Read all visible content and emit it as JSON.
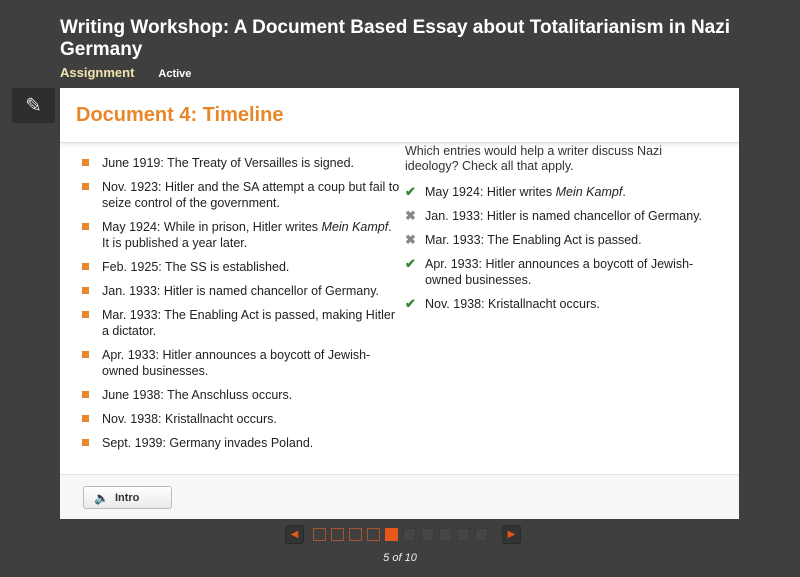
{
  "header": {
    "title": "Writing Workshop: A Document Based Essay about Totalitarianism in Nazi Germany",
    "section": "Assignment",
    "status": "Active"
  },
  "document": {
    "title": "Document 4: Timeline",
    "timeline": [
      {
        "pre": "June 1919: The Treaty of Versailles is signed.",
        "em": "",
        "post": ""
      },
      {
        "pre": "Nov. 1923: Hitler and the SA attempt a coup but fail to seize control of the government.",
        "em": "",
        "post": ""
      },
      {
        "pre": "May 1924: While in prison, Hitler writes ",
        "em": "Mein Kampf",
        "post": ". It is published a year later."
      },
      {
        "pre": "Feb. 1925: The SS is established.",
        "em": "",
        "post": ""
      },
      {
        "pre": "Jan. 1933: Hitler is named chancellor of Germany.",
        "em": "",
        "post": ""
      },
      {
        "pre": "Mar. 1933: The Enabling Act is passed, making Hitler a dictator.",
        "em": "",
        "post": ""
      },
      {
        "pre": "Apr. 1933: Hitler announces a boycott of Jewish-owned businesses.",
        "em": "",
        "post": ""
      },
      {
        "pre": "June 1938: The Anschluss occurs.",
        "em": "",
        "post": ""
      },
      {
        "pre": "Nov. 1938: Kristallnacht occurs.",
        "em": "",
        "post": ""
      },
      {
        "pre": "Sept. 1939: Germany invades Poland.",
        "em": "",
        "post": ""
      }
    ]
  },
  "question": {
    "prompt": "Which entries would help a writer discuss Nazi ideology? Check all that apply.",
    "answers": [
      {
        "pre": "May 1924: Hitler writes ",
        "em": "Mein Kampf",
        "post": ".",
        "correct": true
      },
      {
        "pre": "Jan. 1933: Hitler is named chancellor of Germany.",
        "em": "",
        "post": "",
        "correct": false
      },
      {
        "pre": "Mar. 1933: The Enabling Act is passed.",
        "em": "",
        "post": "",
        "correct": false
      },
      {
        "pre": "Apr. 1933: Hitler announces a boycott of Jewish-owned businesses.",
        "em": "",
        "post": "",
        "correct": true
      },
      {
        "pre": "Nov. 1938: Kristallnacht occurs.",
        "em": "",
        "post": "",
        "correct": true
      }
    ]
  },
  "footer": {
    "intro_label": "Intro"
  },
  "pager": {
    "current": 5,
    "total": 10,
    "label": "5 of 10"
  },
  "colors": {
    "accent": "#e8862a",
    "check": "#2e8b2e",
    "cross": "#888888"
  }
}
